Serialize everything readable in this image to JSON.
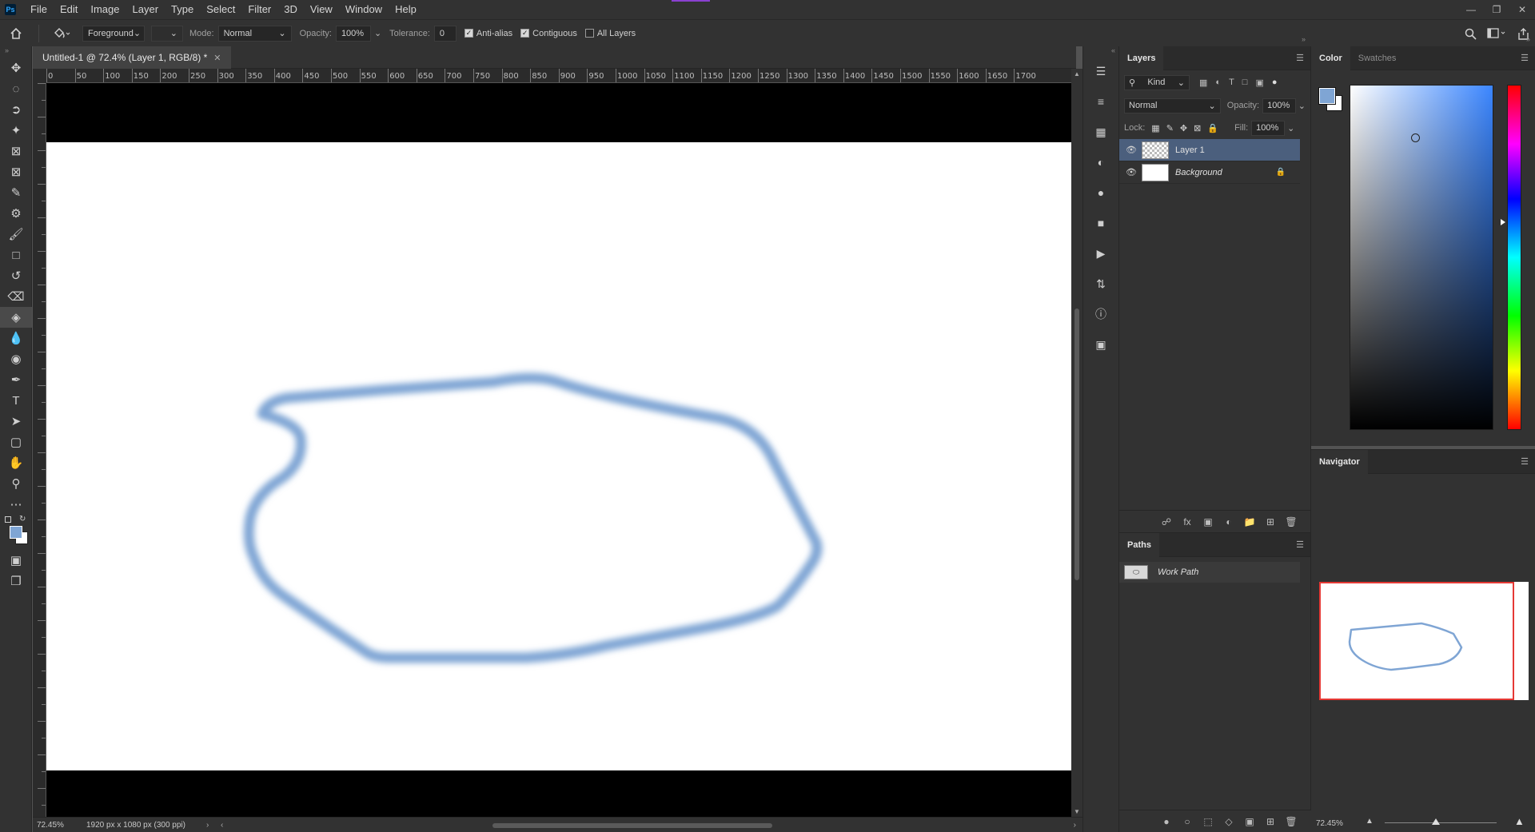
{
  "app": {
    "logo": "Ps",
    "menu": [
      "File",
      "Edit",
      "Image",
      "Layer",
      "Type",
      "Select",
      "Filter",
      "3D",
      "View",
      "Window",
      "Help"
    ]
  },
  "options": {
    "fill_source": "Foreground",
    "mode_label": "Mode:",
    "mode_value": "Normal",
    "opacity_label": "Opacity:",
    "opacity_value": "100%",
    "tolerance_label": "Tolerance:",
    "tolerance_value": "0",
    "anti_alias_label": "Anti-alias",
    "anti_alias_checked": true,
    "contiguous_label": "Contiguous",
    "contiguous_checked": true,
    "all_layers_label": "All Layers",
    "all_layers_checked": false
  },
  "document": {
    "tab_title": "Untitled-1 @ 72.4% (Layer 1, RGB/8) *",
    "ruler_ticks": [
      "0",
      "50",
      "100",
      "150",
      "200",
      "250",
      "300",
      "350",
      "400",
      "450",
      "500",
      "550",
      "600",
      "650",
      "700",
      "750",
      "800",
      "850",
      "900",
      "950",
      "1000",
      "1050",
      "1100",
      "1150",
      "1200",
      "1250",
      "1300",
      "1350",
      "1400",
      "1450",
      "1500",
      "1550",
      "1600",
      "1650",
      "1700"
    ],
    "stroke_color": "#7fa5d4"
  },
  "status": {
    "zoom": "72.45%",
    "doc_info": "1920 px x 1080 px (300 ppi)"
  },
  "layers_panel": {
    "tab": "Layers",
    "filter_kind": "Kind",
    "blend_mode": "Normal",
    "opacity_label": "Opacity:",
    "opacity_value": "100%",
    "lock_label": "Lock:",
    "fill_label": "Fill:",
    "fill_value": "100%",
    "layers": [
      {
        "name": "Layer 1",
        "selected": true
      },
      {
        "name": "Background",
        "selected": false,
        "locked": true
      }
    ]
  },
  "paths_panel": {
    "tab": "Paths",
    "paths": [
      {
        "name": "Work Path"
      }
    ]
  },
  "color_panel": {
    "tabs": [
      "Color",
      "Swatches"
    ],
    "foreground": "#7fa5d4",
    "background": "#ffffff",
    "hue_color": "#3b86ff"
  },
  "navigator_panel": {
    "tab": "Navigator",
    "zoom": "72.45%"
  }
}
